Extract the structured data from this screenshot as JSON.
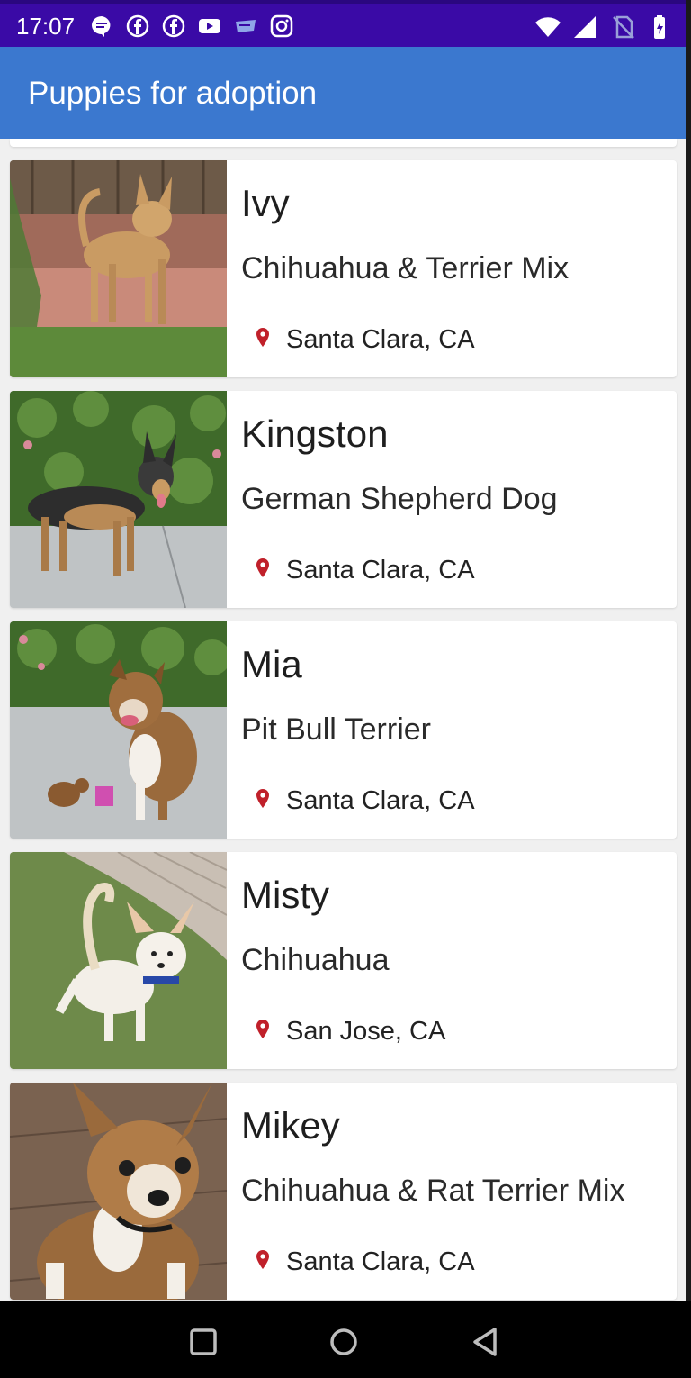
{
  "status_bar": {
    "time": "17:07",
    "icons": [
      "chat-bubble-icon",
      "facebook-icon",
      "facebook-icon",
      "youtube-icon",
      "news-icon",
      "instagram-icon"
    ],
    "right_icons": [
      "wifi-icon",
      "signal-icon",
      "no-sim-icon",
      "battery-icon"
    ]
  },
  "app_bar": {
    "title": "Puppies for adoption",
    "color": "#3b78cf"
  },
  "puppies": [
    {
      "name": "Ivy",
      "breed": "Chihuahua & Terrier Mix",
      "location": "Santa Clara, CA"
    },
    {
      "name": "Kingston",
      "breed": "German Shepherd Dog",
      "location": "Santa Clara, CA"
    },
    {
      "name": "Mia",
      "breed": "Pit Bull Terrier",
      "location": "Santa Clara, CA"
    },
    {
      "name": "Misty",
      "breed": "Chihuahua",
      "location": "San Jose, CA"
    },
    {
      "name": "Mikey",
      "breed": "Chihuahua & Rat Terrier Mix",
      "location": "Santa Clara, CA"
    }
  ],
  "nav_bar": {
    "buttons": [
      "recents-square-icon",
      "home-circle-icon",
      "back-triangle-icon"
    ]
  },
  "colors": {
    "status_bar": "#3a0aa6",
    "location_pin": "#c0202a"
  }
}
